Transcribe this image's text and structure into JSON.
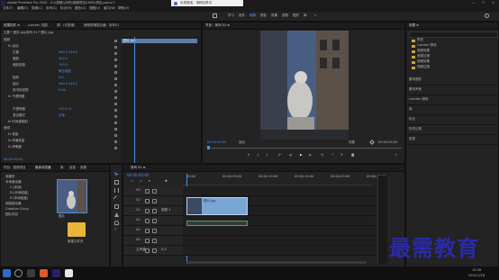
{
  "titlebar": {
    "title": "Adobe Premiere Pro 2020 - D:\\\\视频\\\\示例\\\\视频项目\\\\365\\\\项目.prproj *",
    "notice": "出现错误，请稍后再试"
  },
  "menu": [
    "文件(F)",
    "编辑(E)",
    "剪辑(C)",
    "序列(S)",
    "标记(M)",
    "图形(G)",
    "视图(V)",
    "窗口(W)",
    "帮助(H)"
  ],
  "workspaces": [
    "学习",
    "组件",
    "编辑",
    "颜色",
    "效果",
    "音频",
    "图形",
    "库"
  ],
  "effect_controls": {
    "tabs": [
      "效果控件 ≡",
      "Lumetri 范围",
      "源：(无剪辑)",
      "音频剪辑混合器：序列01"
    ],
    "source": "主要 * 图片.jpg",
    "sequence": "序列 01 * 图片.jpg",
    "rows": [
      {
        "label": "视频",
        "indent": 0
      },
      {
        "label": "fx 运动",
        "indent": 1
      },
      {
        "label": "位置",
        "indent": 2,
        "value": "960.0 540.0"
      },
      {
        "label": "缩放",
        "indent": 2,
        "value": "100.0"
      },
      {
        "label": "缩放宽度",
        "indent": 2,
        "value": "100.0"
      },
      {
        "label": "",
        "indent": 2,
        "value": "等比缩放"
      },
      {
        "label": "旋转",
        "indent": 2,
        "value": "0.0"
      },
      {
        "label": "锚点",
        "indent": 2,
        "value": "960.0 540.0"
      },
      {
        "label": "防闪烁滤镜",
        "indent": 2,
        "value": "0.00"
      },
      {
        "label": "fx 不透明度",
        "indent": 1
      },
      {
        "label": "",
        "indent": 2,
        "value": ""
      },
      {
        "label": "不透明度",
        "indent": 2,
        "value": "100.0 %"
      },
      {
        "label": "混合模式",
        "indent": 2,
        "value": "正常"
      },
      {
        "label": "fx 时间重映射",
        "indent": 1
      },
      {
        "label": "音频",
        "indent": 0
      },
      {
        "label": "fx 音量",
        "indent": 1
      },
      {
        "label": "fx 声道音量",
        "indent": 1
      },
      {
        "label": "fx 声像器",
        "indent": 1
      }
    ],
    "timecode": "00:00:00:00",
    "clip_label": "图片.jpg"
  },
  "program": {
    "tab": "节目：序列 01 ≡",
    "timecode_left": "00:00:00:00",
    "fit": "适合",
    "quality": "完整",
    "timecode_right": "00:00:05:00"
  },
  "project": {
    "tabs": [
      "项目：视频项目",
      "媒体浏览器",
      "库",
      "信息",
      "效果"
    ],
    "tree_items": [
      "收藏夹",
      "本地驱动器",
      "C:(系统)",
      "D:(本地磁盘)",
      "E:(本地磁盘)",
      "网络驱动器",
      "Creative Cloud",
      "团队项目"
    ],
    "thumb_label": "图片",
    "folder_label": "新建文件夹"
  },
  "timeline": {
    "tab": "序列 01 ≡",
    "timecode": "00:00:00:00",
    "ruler": [
      "00:00",
      "00:00:05:00",
      "00:00:10:00",
      "00:00:15:00",
      "00:00:20:00",
      "00:00:25:00"
    ],
    "tracks": [
      {
        "name": "V3",
        "label": ""
      },
      {
        "name": "V2",
        "label": ""
      },
      {
        "name": "V1",
        "label": "视频 1"
      },
      {
        "name": "A1",
        "label": ""
      },
      {
        "name": "A2",
        "label": ""
      },
      {
        "name": "A3",
        "label": ""
      },
      {
        "name": "主声道",
        "label": "0.0"
      }
    ],
    "clip_name": "图片.jpg"
  },
  "right_panel": {
    "title": "效果 ≡",
    "tree": [
      "预设",
      "Lumetri 预设",
      "音频效果",
      "音频过渡",
      "视频效果",
      "视频过渡"
    ],
    "sections": [
      "基本图形",
      "基本声音",
      "Lumetri 颜色",
      "库",
      "标记",
      "历史记录",
      "信息"
    ]
  },
  "watermark": "最需教育",
  "taskbar": {
    "time": "15:28",
    "date": "2021/7/16"
  },
  "colors": {
    "accent": "#4a8fe7",
    "clip": "#7aa6d6",
    "watermark": "#2a2aa8"
  }
}
